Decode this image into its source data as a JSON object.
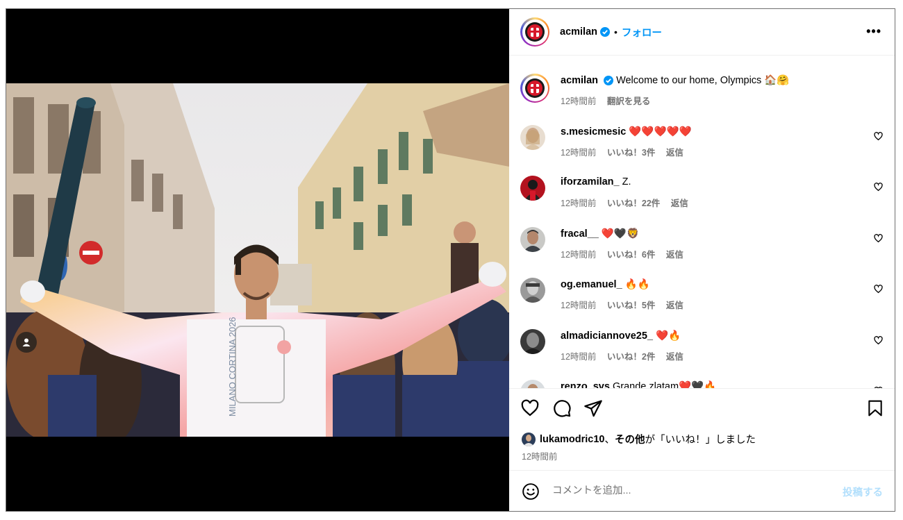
{
  "post": {
    "username": "acmilan",
    "follow_label": "フォロー",
    "separator": "•",
    "more_label": "•••"
  },
  "caption": {
    "username": "acmilan",
    "text": "Welcome to our home, Olympics 🏠🤗",
    "time": "12時間前",
    "translate_label": "翻訳を見る"
  },
  "comments": [
    {
      "username": "s.mesicmesic",
      "text": "❤️❤️❤️❤️❤️",
      "time": "12時間前",
      "likes": "いいね！3件",
      "reply": "返信"
    },
    {
      "username": "iforzamilan_",
      "text": "Z.",
      "time": "12時間前",
      "likes": "いいね！22件",
      "reply": "返信"
    },
    {
      "username": "fracal__",
      "text": "❤️🖤🦁",
      "time": "12時間前",
      "likes": "いいね！6件",
      "reply": "返信"
    },
    {
      "username": "og.emanuel_",
      "text": "🔥🔥",
      "time": "12時間前",
      "likes": "いいね！5件",
      "reply": "返信"
    },
    {
      "username": "almadiciannove25_",
      "text": "❤️🔥",
      "time": "12時間前",
      "likes": "いいね！2件",
      "reply": "返信"
    },
    {
      "username": "renzo_svs",
      "text": "Grande zlatam❤️🖤🔥",
      "time": "",
      "likes": "",
      "reply": ""
    }
  ],
  "likes_summary": {
    "first_user": "lukamodric10",
    "sep": "、",
    "others": "その他",
    "suffix": "が「いいね！」しました",
    "time": "12時間前"
  },
  "composer": {
    "placeholder": "コメントを追加...",
    "post_label": "投稿する"
  },
  "photo": {
    "torch_text": "MILANO CORTINA 2026"
  },
  "colors": {
    "link_blue": "#0095f6",
    "post_disabled": "#b2dffc",
    "meta_gray": "#737373",
    "heart_red": "#e0102a",
    "milan_red": "#d6182a"
  }
}
